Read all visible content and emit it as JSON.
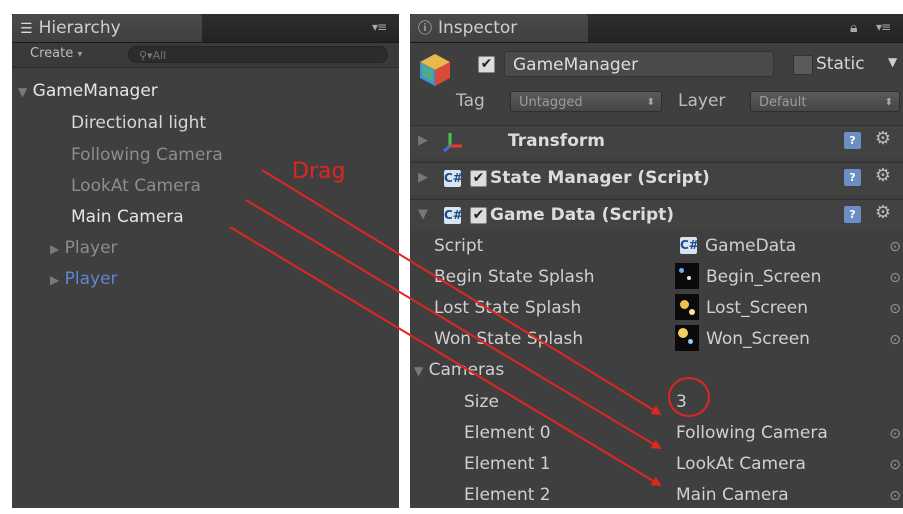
{
  "hierarchy": {
    "tab_title": "Hierarchy",
    "create_label": "Create",
    "search_placeholder": "All",
    "root": "GameManager",
    "children": [
      "Directional light",
      "Following Camera",
      "LookAt Camera",
      "Main Camera",
      "Player",
      "Player"
    ]
  },
  "inspector": {
    "tab_title": "Inspector",
    "object_name": "GameManager",
    "static_label": "Static",
    "tag_label": "Tag",
    "tag_value": "Untagged",
    "layer_label": "Layer",
    "layer_value": "Default",
    "components": {
      "transform": "Transform",
      "state_manager": "State Manager (Script)",
      "game_data": "Game Data (Script)"
    },
    "properties": {
      "script_label": "Script",
      "script_value": "GameData",
      "begin_label": "Begin State Splash",
      "begin_value": "Begin_Screen",
      "lost_label": "Lost State Splash",
      "lost_value": "Lost_Screen",
      "won_label": "Won State Splash",
      "won_value": "Won_Screen",
      "cameras_label": "Cameras",
      "size_label": "Size",
      "size_value": "3",
      "elements": [
        {
          "label": "Element 0",
          "value": "Following Camera"
        },
        {
          "label": "Element 1",
          "value": "LookAt Camera"
        },
        {
          "label": "Element 2",
          "value": "Main Camera"
        }
      ]
    }
  },
  "annotation": {
    "drag_label": "Drag",
    "color": "#e0261e"
  },
  "colors": {
    "panel": "#3f3f3f",
    "selected_child": "#5f86d1",
    "dim_text": "#9a9a9a"
  }
}
